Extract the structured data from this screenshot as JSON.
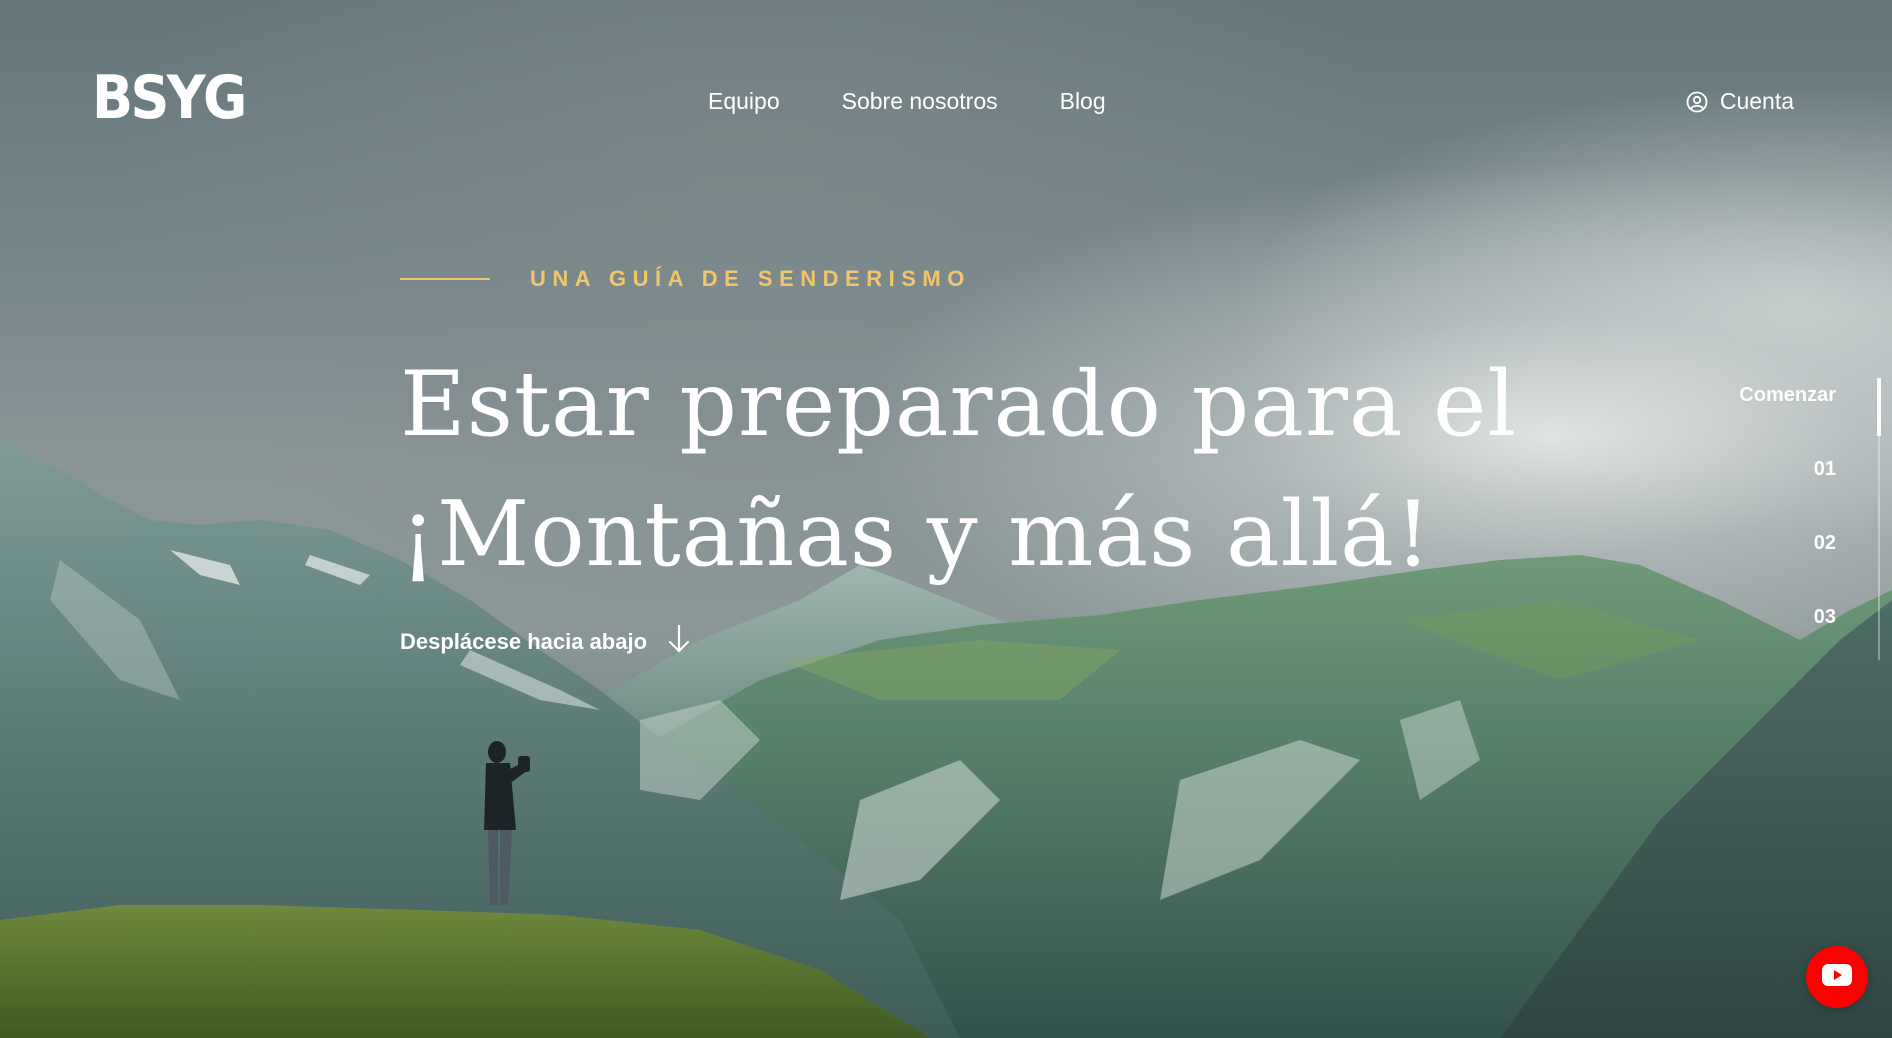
{
  "header": {
    "logo": "BSYG",
    "nav": [
      {
        "label": "Equipo"
      },
      {
        "label": "Sobre nosotros"
      },
      {
        "label": "Blog"
      }
    ],
    "account": {
      "label": "Cuenta",
      "icon": "user-circle-icon"
    }
  },
  "hero": {
    "eyebrow": "UNA GUÍA DE SENDERISMO",
    "headline_line1": "Estar preparado para el",
    "headline_line2": "¡Montañas y más allá!",
    "scroll_label": "Desplácese hacia abajo",
    "scroll_icon": "arrow-down-icon"
  },
  "pager": {
    "items": [
      {
        "label": "Comenzar",
        "active": true
      },
      {
        "label": "01",
        "active": false
      },
      {
        "label": "02",
        "active": false
      },
      {
        "label": "03",
        "active": false
      }
    ]
  },
  "floating": {
    "youtube_icon": "youtube-icon"
  },
  "colors": {
    "accent": "#f1c56c",
    "text": "#ffffff",
    "youtube": "#ff0000"
  }
}
